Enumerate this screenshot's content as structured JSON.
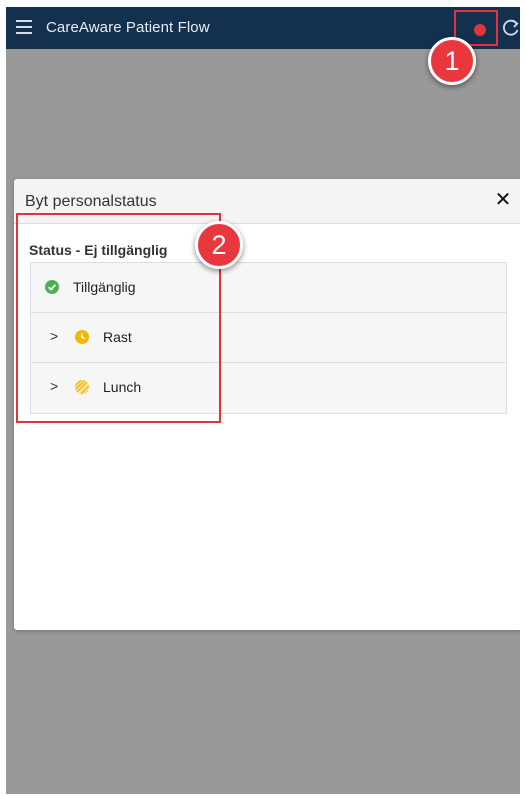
{
  "app": {
    "title": "CareAware Patient Flow",
    "header_color": "#14304f",
    "status_indicator_color": "#e0333b"
  },
  "callouts": [
    "1",
    "2"
  ],
  "dialog": {
    "title": "Byt personalstatus",
    "close_glyph": "✕",
    "section_title": "Status - Ej tillgänglig",
    "items": [
      {
        "label": "Tillgänglig",
        "icon": "check-circle-icon",
        "color": "#4caf50",
        "expandable": false
      },
      {
        "label": "Rast",
        "icon": "clock-icon",
        "color": "#f5b800",
        "expandable": true
      },
      {
        "label": "Lunch",
        "icon": "striped-circle-icon",
        "color": "#f5c85a",
        "expandable": true
      }
    ],
    "chevron_glyph": ">"
  }
}
